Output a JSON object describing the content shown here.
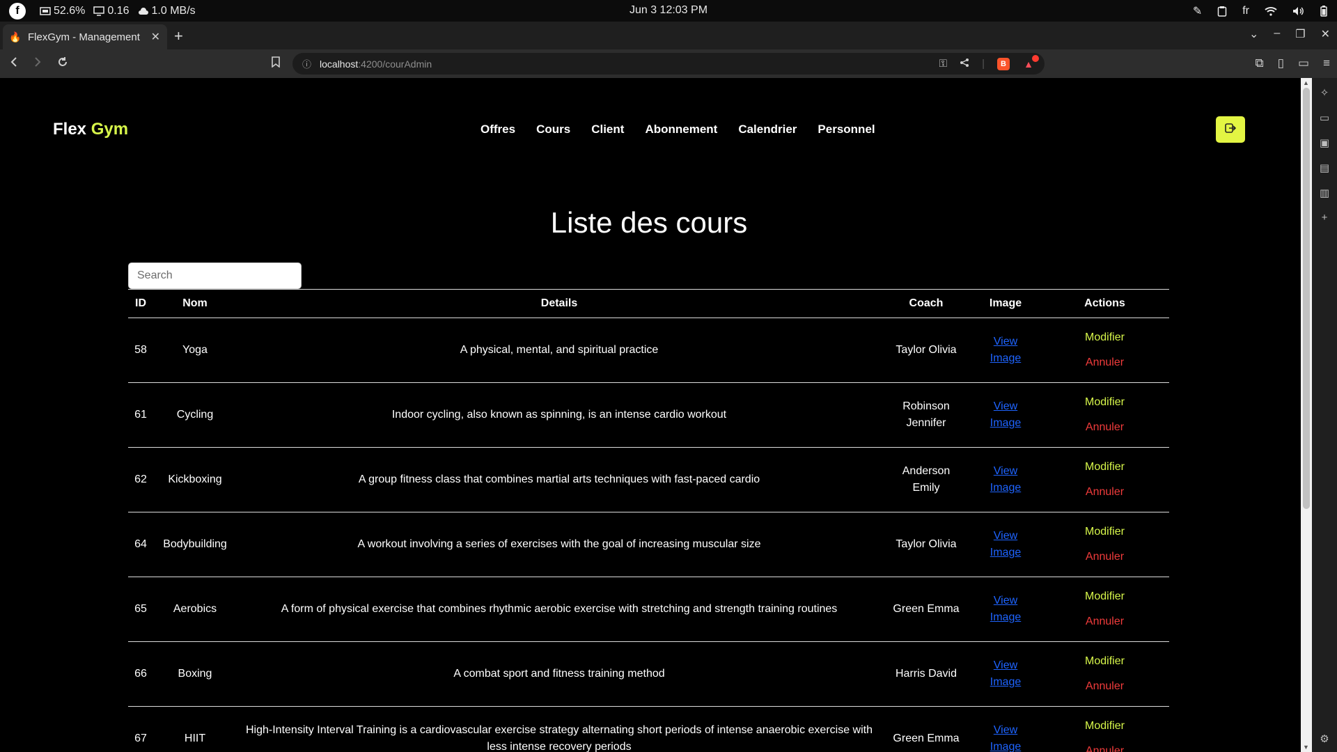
{
  "os_bar": {
    "cpu": "52.6%",
    "load": "0.16",
    "network": "1.0 MB/s",
    "datetime": "Jun 3  12:03 PM",
    "lang": "fr"
  },
  "browser": {
    "tab_title": "FlexGym - Management",
    "url_host": "localhost",
    "url_path": ":4200/courAdmin"
  },
  "app": {
    "brand_first": "Flex",
    "brand_second": "Gym",
    "nav": [
      "Offres",
      "Cours",
      "Client",
      "Abonnement",
      "Calendrier",
      "Personnel"
    ]
  },
  "page": {
    "title": "Liste des cours",
    "search_placeholder": "Search"
  },
  "table": {
    "headers": [
      "ID",
      "Nom",
      "Details",
      "Coach",
      "Image",
      "Actions"
    ],
    "view_label": "View Image",
    "modify_label": "Modifier",
    "cancel_label": "Annuler",
    "rows": [
      {
        "id": "58",
        "nom": "Yoga",
        "details": "A physical, mental, and spiritual practice",
        "coach": "Taylor Olivia"
      },
      {
        "id": "61",
        "nom": "Cycling",
        "details": "Indoor cycling, also known as spinning, is an intense cardio workout",
        "coach": "Robinson Jennifer"
      },
      {
        "id": "62",
        "nom": "Kickboxing",
        "details": "A group fitness class that combines martial arts techniques with fast-paced cardio",
        "coach": "Anderson Emily"
      },
      {
        "id": "64",
        "nom": "Bodybuilding",
        "details": "A workout involving a series of exercises with the goal of increasing muscular size",
        "coach": "Taylor Olivia"
      },
      {
        "id": "65",
        "nom": "Aerobics",
        "details": "A form of physical exercise that combines rhythmic aerobic exercise with stretching and strength training routines",
        "coach": "Green Emma"
      },
      {
        "id": "66",
        "nom": "Boxing",
        "details": "A combat sport and fitness training method",
        "coach": "Harris David"
      },
      {
        "id": "67",
        "nom": "HIIT",
        "details": "High-Intensity Interval Training is a cardiovascular exercise strategy alternating short periods of intense anaerobic exercise with less intense recovery periods",
        "coach": "Green Emma"
      }
    ]
  },
  "colors": {
    "accent": "#d7f64a",
    "danger": "#f03b3b",
    "link": "#1e64ff"
  }
}
